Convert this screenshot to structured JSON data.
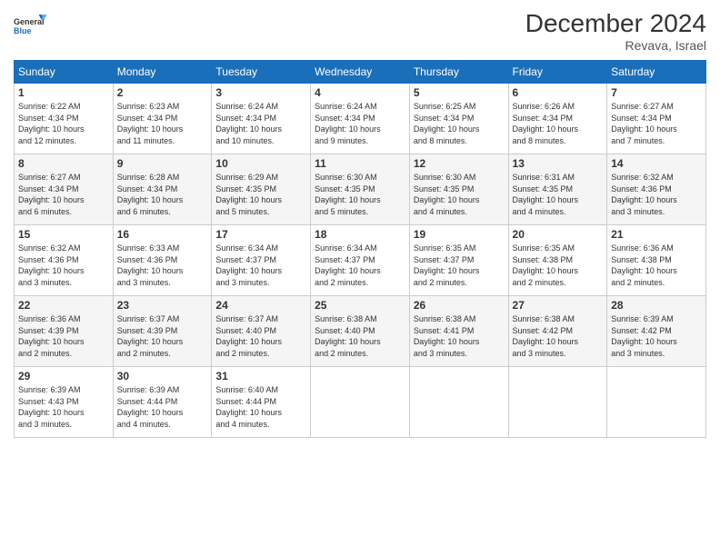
{
  "logo": {
    "line1": "General",
    "line2": "Blue"
  },
  "title": "December 2024",
  "subtitle": "Revava, Israel",
  "weekdays": [
    "Sunday",
    "Monday",
    "Tuesday",
    "Wednesday",
    "Thursday",
    "Friday",
    "Saturday"
  ],
  "weeks": [
    [
      {
        "day": "1",
        "sunrise": "6:22 AM",
        "sunset": "4:34 PM",
        "daylight": "10 hours and 12 minutes."
      },
      {
        "day": "2",
        "sunrise": "6:23 AM",
        "sunset": "4:34 PM",
        "daylight": "10 hours and 11 minutes."
      },
      {
        "day": "3",
        "sunrise": "6:24 AM",
        "sunset": "4:34 PM",
        "daylight": "10 hours and 10 minutes."
      },
      {
        "day": "4",
        "sunrise": "6:24 AM",
        "sunset": "4:34 PM",
        "daylight": "10 hours and 9 minutes."
      },
      {
        "day": "5",
        "sunrise": "6:25 AM",
        "sunset": "4:34 PM",
        "daylight": "10 hours and 8 minutes."
      },
      {
        "day": "6",
        "sunrise": "6:26 AM",
        "sunset": "4:34 PM",
        "daylight": "10 hours and 8 minutes."
      },
      {
        "day": "7",
        "sunrise": "6:27 AM",
        "sunset": "4:34 PM",
        "daylight": "10 hours and 7 minutes."
      }
    ],
    [
      {
        "day": "8",
        "sunrise": "6:27 AM",
        "sunset": "4:34 PM",
        "daylight": "10 hours and 6 minutes."
      },
      {
        "day": "9",
        "sunrise": "6:28 AM",
        "sunset": "4:34 PM",
        "daylight": "10 hours and 6 minutes."
      },
      {
        "day": "10",
        "sunrise": "6:29 AM",
        "sunset": "4:35 PM",
        "daylight": "10 hours and 5 minutes."
      },
      {
        "day": "11",
        "sunrise": "6:30 AM",
        "sunset": "4:35 PM",
        "daylight": "10 hours and 5 minutes."
      },
      {
        "day": "12",
        "sunrise": "6:30 AM",
        "sunset": "4:35 PM",
        "daylight": "10 hours and 4 minutes."
      },
      {
        "day": "13",
        "sunrise": "6:31 AM",
        "sunset": "4:35 PM",
        "daylight": "10 hours and 4 minutes."
      },
      {
        "day": "14",
        "sunrise": "6:32 AM",
        "sunset": "4:36 PM",
        "daylight": "10 hours and 3 minutes."
      }
    ],
    [
      {
        "day": "15",
        "sunrise": "6:32 AM",
        "sunset": "4:36 PM",
        "daylight": "10 hours and 3 minutes."
      },
      {
        "day": "16",
        "sunrise": "6:33 AM",
        "sunset": "4:36 PM",
        "daylight": "10 hours and 3 minutes."
      },
      {
        "day": "17",
        "sunrise": "6:34 AM",
        "sunset": "4:37 PM",
        "daylight": "10 hours and 3 minutes."
      },
      {
        "day": "18",
        "sunrise": "6:34 AM",
        "sunset": "4:37 PM",
        "daylight": "10 hours and 2 minutes."
      },
      {
        "day": "19",
        "sunrise": "6:35 AM",
        "sunset": "4:37 PM",
        "daylight": "10 hours and 2 minutes."
      },
      {
        "day": "20",
        "sunrise": "6:35 AM",
        "sunset": "4:38 PM",
        "daylight": "10 hours and 2 minutes."
      },
      {
        "day": "21",
        "sunrise": "6:36 AM",
        "sunset": "4:38 PM",
        "daylight": "10 hours and 2 minutes."
      }
    ],
    [
      {
        "day": "22",
        "sunrise": "6:36 AM",
        "sunset": "4:39 PM",
        "daylight": "10 hours and 2 minutes."
      },
      {
        "day": "23",
        "sunrise": "6:37 AM",
        "sunset": "4:39 PM",
        "daylight": "10 hours and 2 minutes."
      },
      {
        "day": "24",
        "sunrise": "6:37 AM",
        "sunset": "4:40 PM",
        "daylight": "10 hours and 2 minutes."
      },
      {
        "day": "25",
        "sunrise": "6:38 AM",
        "sunset": "4:40 PM",
        "daylight": "10 hours and 2 minutes."
      },
      {
        "day": "26",
        "sunrise": "6:38 AM",
        "sunset": "4:41 PM",
        "daylight": "10 hours and 3 minutes."
      },
      {
        "day": "27",
        "sunrise": "6:38 AM",
        "sunset": "4:42 PM",
        "daylight": "10 hours and 3 minutes."
      },
      {
        "day": "28",
        "sunrise": "6:39 AM",
        "sunset": "4:42 PM",
        "daylight": "10 hours and 3 minutes."
      }
    ],
    [
      {
        "day": "29",
        "sunrise": "6:39 AM",
        "sunset": "4:43 PM",
        "daylight": "10 hours and 3 minutes."
      },
      {
        "day": "30",
        "sunrise": "6:39 AM",
        "sunset": "4:44 PM",
        "daylight": "10 hours and 4 minutes."
      },
      {
        "day": "31",
        "sunrise": "6:40 AM",
        "sunset": "4:44 PM",
        "daylight": "10 hours and 4 minutes."
      },
      null,
      null,
      null,
      null
    ]
  ],
  "labels": {
    "sunrise": "Sunrise:",
    "sunset": "Sunset:",
    "daylight": "Daylight:"
  }
}
